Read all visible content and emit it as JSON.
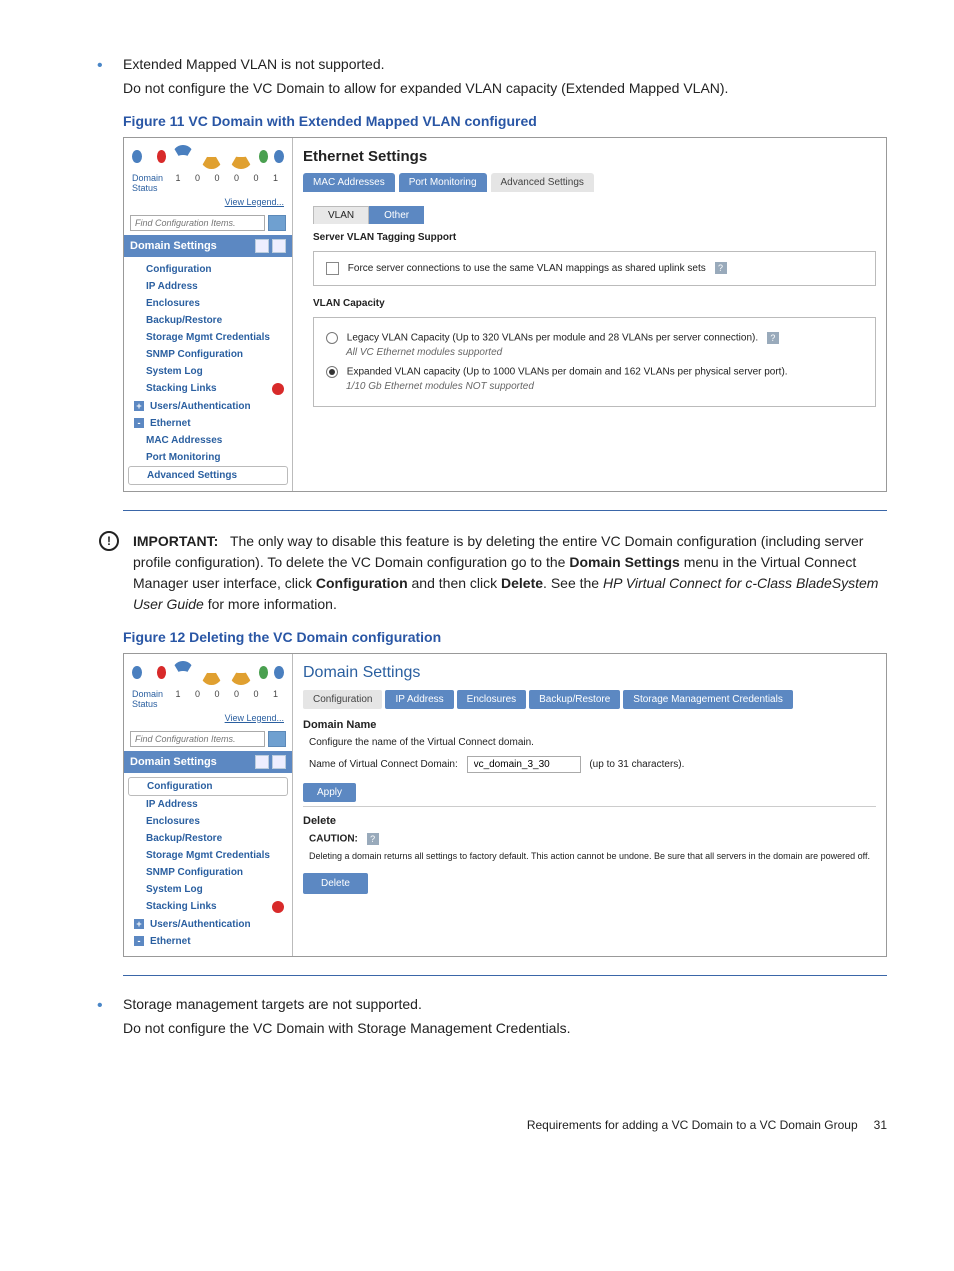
{
  "bullet1": {
    "title": "Extended Mapped VLAN is not supported.",
    "sub": "Do not configure the VC Domain to allow for expanded VLAN capacity (Extended Mapped VLAN)."
  },
  "fig11": "Figure 11 VC Domain with Extended Mapped VLAN configured",
  "sidebar": {
    "domain": "Domain",
    "status": "Status",
    "numbers": "1 0 0 0 0 1",
    "legend": "View Legend...",
    "search_placeholder": "Find Configuration Items.",
    "header": "Domain Settings",
    "items": [
      "Configuration",
      "IP Address",
      "Enclosures",
      "Backup/Restore",
      "Storage Mgmt Credentials",
      "SNMP Configuration",
      "System Log",
      "Stacking Links"
    ],
    "users": "Users/Authentication",
    "ethernet": "Ethernet",
    "eth_children": [
      "MAC Addresses",
      "Port Monitoring",
      "Advanced Settings"
    ]
  },
  "eth_panel": {
    "title": "Ethernet Settings",
    "tabs": [
      "MAC Addresses",
      "Port Monitoring",
      "Advanced Settings"
    ],
    "subtabs": [
      "VLAN",
      "Other"
    ],
    "section1_label": "Server VLAN Tagging Support",
    "section1_check": "Force server connections to use the same VLAN mappings as shared uplink sets",
    "section2_label": "VLAN Capacity",
    "opt1": "Legacy VLAN Capacity (Up to 320 VLANs per module and 28 VLANs per server connection).",
    "opt1_note": "All VC Ethernet modules supported",
    "opt2": "Expanded VLAN capacity (Up to 1000 VLANs per domain and 162 VLANs per physical server port).",
    "opt2_note": "1/10 Gb Ethernet modules NOT supported"
  },
  "important": {
    "label": "IMPORTANT:",
    "text1": "The only way to disable this feature is by deleting the entire VC Domain configuration (including server profile configuration). To delete the VC Domain configuration go to the ",
    "bold1": "Domain Settings",
    "text2": " menu in the Virtual Connect Manager user interface, click ",
    "bold2": "Configuration",
    "text3": " and then click ",
    "bold3": "Delete",
    "text4": ". See the ",
    "italic": "HP Virtual Connect for c-Class BladeSystem User Guide",
    "text5": " for more information."
  },
  "fig12": "Figure 12 Deleting the VC Domain configuration",
  "domain_panel": {
    "title": "Domain Settings",
    "tabs": [
      "Configuration",
      "IP Address",
      "Enclosures",
      "Backup/Restore",
      "Storage Management Credentials"
    ],
    "dn_label": "Domain Name",
    "dn_desc": "Configure the name of the Virtual Connect domain.",
    "dn_field": "Name of Virtual Connect Domain:",
    "dn_value": "vc_domain_3_30",
    "dn_hint": "(up to 31 characters).",
    "apply": "Apply",
    "del_label": "Delete",
    "caution": "CAUTION:",
    "caution_text": "Deleting a domain returns all settings to factory default. This action cannot be undone. Be sure that all servers in the domain are powered off.",
    "delete_btn": "Delete"
  },
  "bullet2": {
    "title": "Storage management targets are not supported.",
    "sub": "Do not configure the VC Domain with Storage Management Credentials."
  },
  "footer": {
    "text": "Requirements for adding a VC Domain to a VC Domain Group",
    "page": "31"
  }
}
